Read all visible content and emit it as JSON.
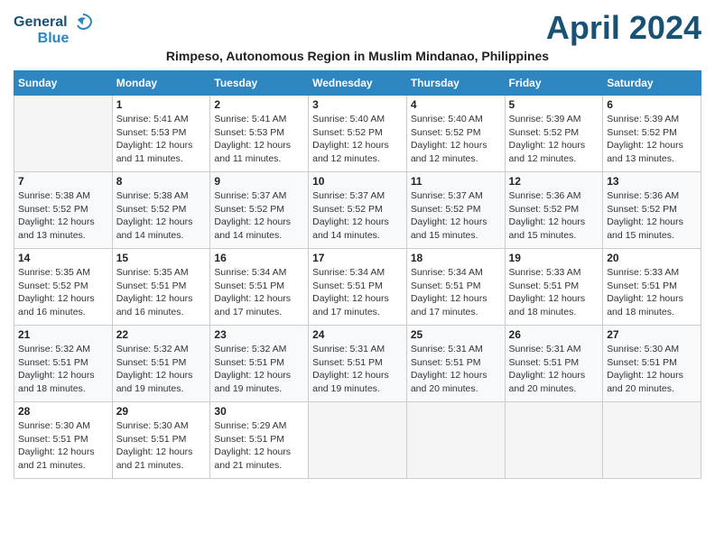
{
  "header": {
    "logo_line1": "General",
    "logo_line2": "Blue",
    "title": "April 2024",
    "subtitle": "Rimpeso, Autonomous Region in Muslim Mindanao, Philippines"
  },
  "weekdays": [
    "Sunday",
    "Monday",
    "Tuesday",
    "Wednesday",
    "Thursday",
    "Friday",
    "Saturday"
  ],
  "weeks": [
    [
      {
        "day": "",
        "info": ""
      },
      {
        "day": "1",
        "info": "Sunrise: 5:41 AM\nSunset: 5:53 PM\nDaylight: 12 hours\nand 11 minutes."
      },
      {
        "day": "2",
        "info": "Sunrise: 5:41 AM\nSunset: 5:53 PM\nDaylight: 12 hours\nand 11 minutes."
      },
      {
        "day": "3",
        "info": "Sunrise: 5:40 AM\nSunset: 5:52 PM\nDaylight: 12 hours\nand 12 minutes."
      },
      {
        "day": "4",
        "info": "Sunrise: 5:40 AM\nSunset: 5:52 PM\nDaylight: 12 hours\nand 12 minutes."
      },
      {
        "day": "5",
        "info": "Sunrise: 5:39 AM\nSunset: 5:52 PM\nDaylight: 12 hours\nand 12 minutes."
      },
      {
        "day": "6",
        "info": "Sunrise: 5:39 AM\nSunset: 5:52 PM\nDaylight: 12 hours\nand 13 minutes."
      }
    ],
    [
      {
        "day": "7",
        "info": "Sunrise: 5:38 AM\nSunset: 5:52 PM\nDaylight: 12 hours\nand 13 minutes."
      },
      {
        "day": "8",
        "info": "Sunrise: 5:38 AM\nSunset: 5:52 PM\nDaylight: 12 hours\nand 14 minutes."
      },
      {
        "day": "9",
        "info": "Sunrise: 5:37 AM\nSunset: 5:52 PM\nDaylight: 12 hours\nand 14 minutes."
      },
      {
        "day": "10",
        "info": "Sunrise: 5:37 AM\nSunset: 5:52 PM\nDaylight: 12 hours\nand 14 minutes."
      },
      {
        "day": "11",
        "info": "Sunrise: 5:37 AM\nSunset: 5:52 PM\nDaylight: 12 hours\nand 15 minutes."
      },
      {
        "day": "12",
        "info": "Sunrise: 5:36 AM\nSunset: 5:52 PM\nDaylight: 12 hours\nand 15 minutes."
      },
      {
        "day": "13",
        "info": "Sunrise: 5:36 AM\nSunset: 5:52 PM\nDaylight: 12 hours\nand 15 minutes."
      }
    ],
    [
      {
        "day": "14",
        "info": "Sunrise: 5:35 AM\nSunset: 5:52 PM\nDaylight: 12 hours\nand 16 minutes."
      },
      {
        "day": "15",
        "info": "Sunrise: 5:35 AM\nSunset: 5:51 PM\nDaylight: 12 hours\nand 16 minutes."
      },
      {
        "day": "16",
        "info": "Sunrise: 5:34 AM\nSunset: 5:51 PM\nDaylight: 12 hours\nand 17 minutes."
      },
      {
        "day": "17",
        "info": "Sunrise: 5:34 AM\nSunset: 5:51 PM\nDaylight: 12 hours\nand 17 minutes."
      },
      {
        "day": "18",
        "info": "Sunrise: 5:34 AM\nSunset: 5:51 PM\nDaylight: 12 hours\nand 17 minutes."
      },
      {
        "day": "19",
        "info": "Sunrise: 5:33 AM\nSunset: 5:51 PM\nDaylight: 12 hours\nand 18 minutes."
      },
      {
        "day": "20",
        "info": "Sunrise: 5:33 AM\nSunset: 5:51 PM\nDaylight: 12 hours\nand 18 minutes."
      }
    ],
    [
      {
        "day": "21",
        "info": "Sunrise: 5:32 AM\nSunset: 5:51 PM\nDaylight: 12 hours\nand 18 minutes."
      },
      {
        "day": "22",
        "info": "Sunrise: 5:32 AM\nSunset: 5:51 PM\nDaylight: 12 hours\nand 19 minutes."
      },
      {
        "day": "23",
        "info": "Sunrise: 5:32 AM\nSunset: 5:51 PM\nDaylight: 12 hours\nand 19 minutes."
      },
      {
        "day": "24",
        "info": "Sunrise: 5:31 AM\nSunset: 5:51 PM\nDaylight: 12 hours\nand 19 minutes."
      },
      {
        "day": "25",
        "info": "Sunrise: 5:31 AM\nSunset: 5:51 PM\nDaylight: 12 hours\nand 20 minutes."
      },
      {
        "day": "26",
        "info": "Sunrise: 5:31 AM\nSunset: 5:51 PM\nDaylight: 12 hours\nand 20 minutes."
      },
      {
        "day": "27",
        "info": "Sunrise: 5:30 AM\nSunset: 5:51 PM\nDaylight: 12 hours\nand 20 minutes."
      }
    ],
    [
      {
        "day": "28",
        "info": "Sunrise: 5:30 AM\nSunset: 5:51 PM\nDaylight: 12 hours\nand 21 minutes."
      },
      {
        "day": "29",
        "info": "Sunrise: 5:30 AM\nSunset: 5:51 PM\nDaylight: 12 hours\nand 21 minutes."
      },
      {
        "day": "30",
        "info": "Sunrise: 5:29 AM\nSunset: 5:51 PM\nDaylight: 12 hours\nand 21 minutes."
      },
      {
        "day": "",
        "info": ""
      },
      {
        "day": "",
        "info": ""
      },
      {
        "day": "",
        "info": ""
      },
      {
        "day": "",
        "info": ""
      }
    ]
  ]
}
